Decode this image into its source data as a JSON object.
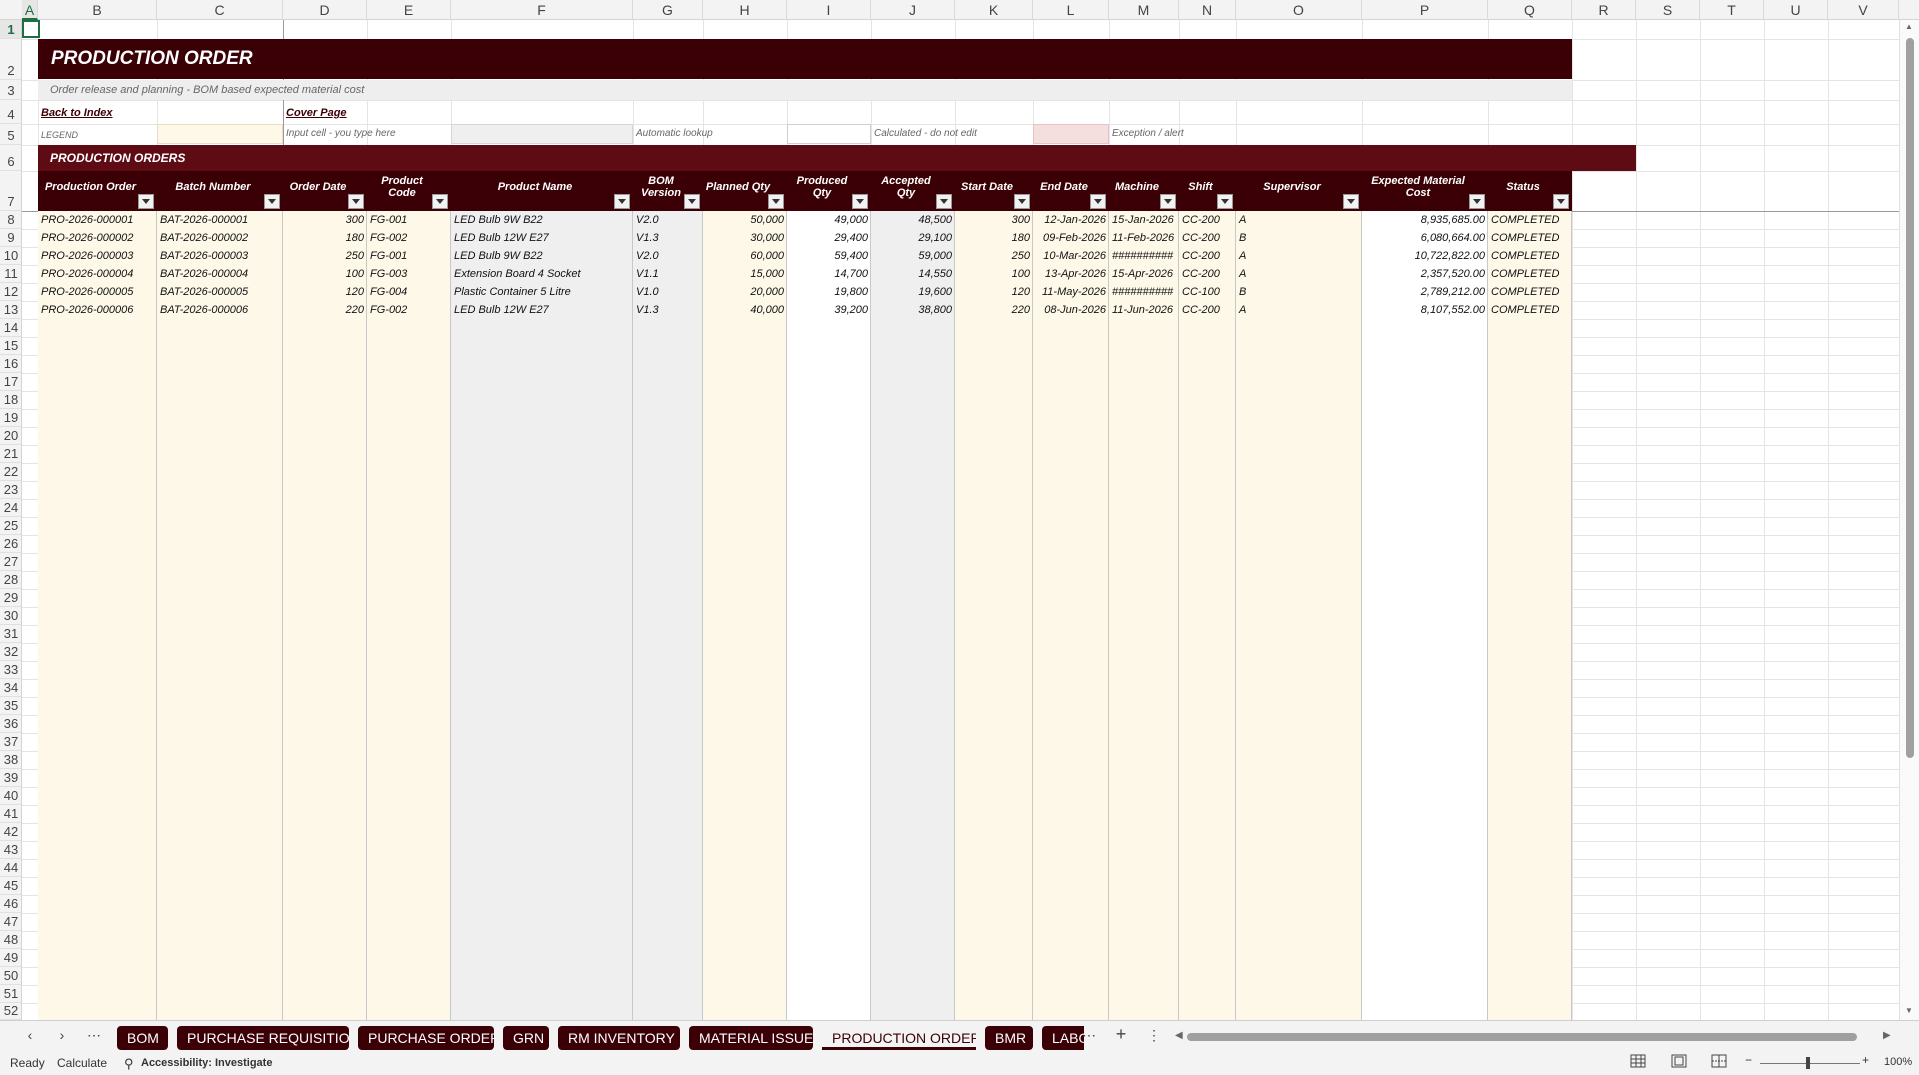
{
  "column_letters": [
    "A",
    "B",
    "C",
    "D",
    "E",
    "F",
    "G",
    "H",
    "I",
    "J",
    "K",
    "L",
    "M",
    "N",
    "O",
    "P",
    "Q",
    "R",
    "S",
    "T",
    "U",
    "V"
  ],
  "row_numbers": [
    1,
    2,
    3,
    4,
    5,
    6,
    7,
    8,
    9,
    10,
    11,
    12,
    13,
    14,
    15,
    16,
    17,
    18,
    19,
    20,
    21,
    22,
    23,
    24,
    25,
    26,
    27,
    28,
    29,
    30,
    31,
    32,
    33,
    34,
    35,
    36,
    37,
    38,
    39,
    40,
    41,
    42,
    43,
    44,
    45,
    46,
    47,
    48,
    49,
    50,
    51,
    52
  ],
  "sheet": {
    "title": "PRODUCTION ORDER",
    "subtitle": "Order release and planning - BOM based expected material cost",
    "back_link": "Back to Index",
    "cover_link": "Cover Page",
    "legend_label": "LEGEND",
    "legend": {
      "input": "Input cell - you type here",
      "lookup": "Automatic lookup",
      "calculated": "Calculated - do not edit",
      "exception": "Exception / alert"
    },
    "section_title": "PRODUCTION ORDERS"
  },
  "table": {
    "headers": [
      "Production Order",
      "Batch Number",
      "Order Date",
      "Product Code",
      "Product Name",
      "BOM Version",
      "Planned Qty",
      "Produced Qty",
      "Accepted Qty",
      "Start Date",
      "End Date",
      "Machine",
      "Shift",
      "Supervisor",
      "Expected Material Cost",
      "Status"
    ],
    "rows": [
      [
        "PRO-2026-000001",
        "BAT-2026-000001",
        "300",
        "FG-001",
        "LED Bulb 9W B22",
        "V2.0",
        "50,000",
        "49,000",
        "48,500",
        "300",
        "12-Jan-2026",
        "15-Jan-2026",
        "CC-200",
        "A",
        "",
        "8,935,685.00",
        "COMPLETED"
      ],
      [
        "PRO-2026-000002",
        "BAT-2026-000002",
        "180",
        "FG-002",
        "LED Bulb 12W E27",
        "V1.3",
        "30,000",
        "29,400",
        "29,100",
        "180",
        "09-Feb-2026",
        "11-Feb-2026",
        "CC-200",
        "B",
        "",
        "6,080,664.00",
        "COMPLETED"
      ],
      [
        "PRO-2026-000003",
        "BAT-2026-000003",
        "250",
        "FG-001",
        "LED Bulb 9W B22",
        "V2.0",
        "60,000",
        "59,400",
        "59,000",
        "250",
        "10-Mar-2026",
        "##########",
        "CC-200",
        "A",
        "",
        "10,722,822.00",
        "COMPLETED"
      ],
      [
        "PRO-2026-000004",
        "BAT-2026-000004",
        "100",
        "FG-003",
        "Extension Board 4 Socket",
        "V1.1",
        "15,000",
        "14,700",
        "14,550",
        "100",
        "13-Apr-2026",
        "15-Apr-2026",
        "CC-200",
        "A",
        "",
        "2,357,520.00",
        "COMPLETED"
      ],
      [
        "PRO-2026-000005",
        "BAT-2026-000005",
        "120",
        "FG-004",
        "Plastic Container 5 Litre",
        "V1.0",
        "20,000",
        "19,800",
        "19,600",
        "120",
        "11-May-2026",
        "##########",
        "CC-100",
        "B",
        "",
        "2,789,212.00",
        "COMPLETED"
      ],
      [
        "PRO-2026-000006",
        "BAT-2026-000006",
        "220",
        "FG-002",
        "LED Bulb 12W E27",
        "V1.3",
        "40,000",
        "39,200",
        "38,800",
        "220",
        "08-Jun-2026",
        "11-Jun-2026",
        "CC-200",
        "A",
        "",
        "8,107,552.00",
        "COMPLETED"
      ]
    ]
  },
  "tabs": [
    "BOM",
    "PURCHASE REQUISITION",
    "PURCHASE ORDER",
    "GRN",
    "RM INVENTORY",
    "MATERIAL ISSUE",
    "PRODUCTION ORDER",
    "BMR",
    "LABO"
  ],
  "active_tab": "PRODUCTION ORDER",
  "status": {
    "ready": "Ready",
    "calculate": "Calculate",
    "accessibility": "Accessibility: Investigate",
    "zoom": "100%"
  },
  "colors": {
    "header_dark": "#3b0006",
    "section": "#5e0b14",
    "input_fill": "#fdf8e8",
    "lookup_fill": "#efefef",
    "exception_fill": "#f4dede",
    "excel_green": "#1f6e43"
  }
}
